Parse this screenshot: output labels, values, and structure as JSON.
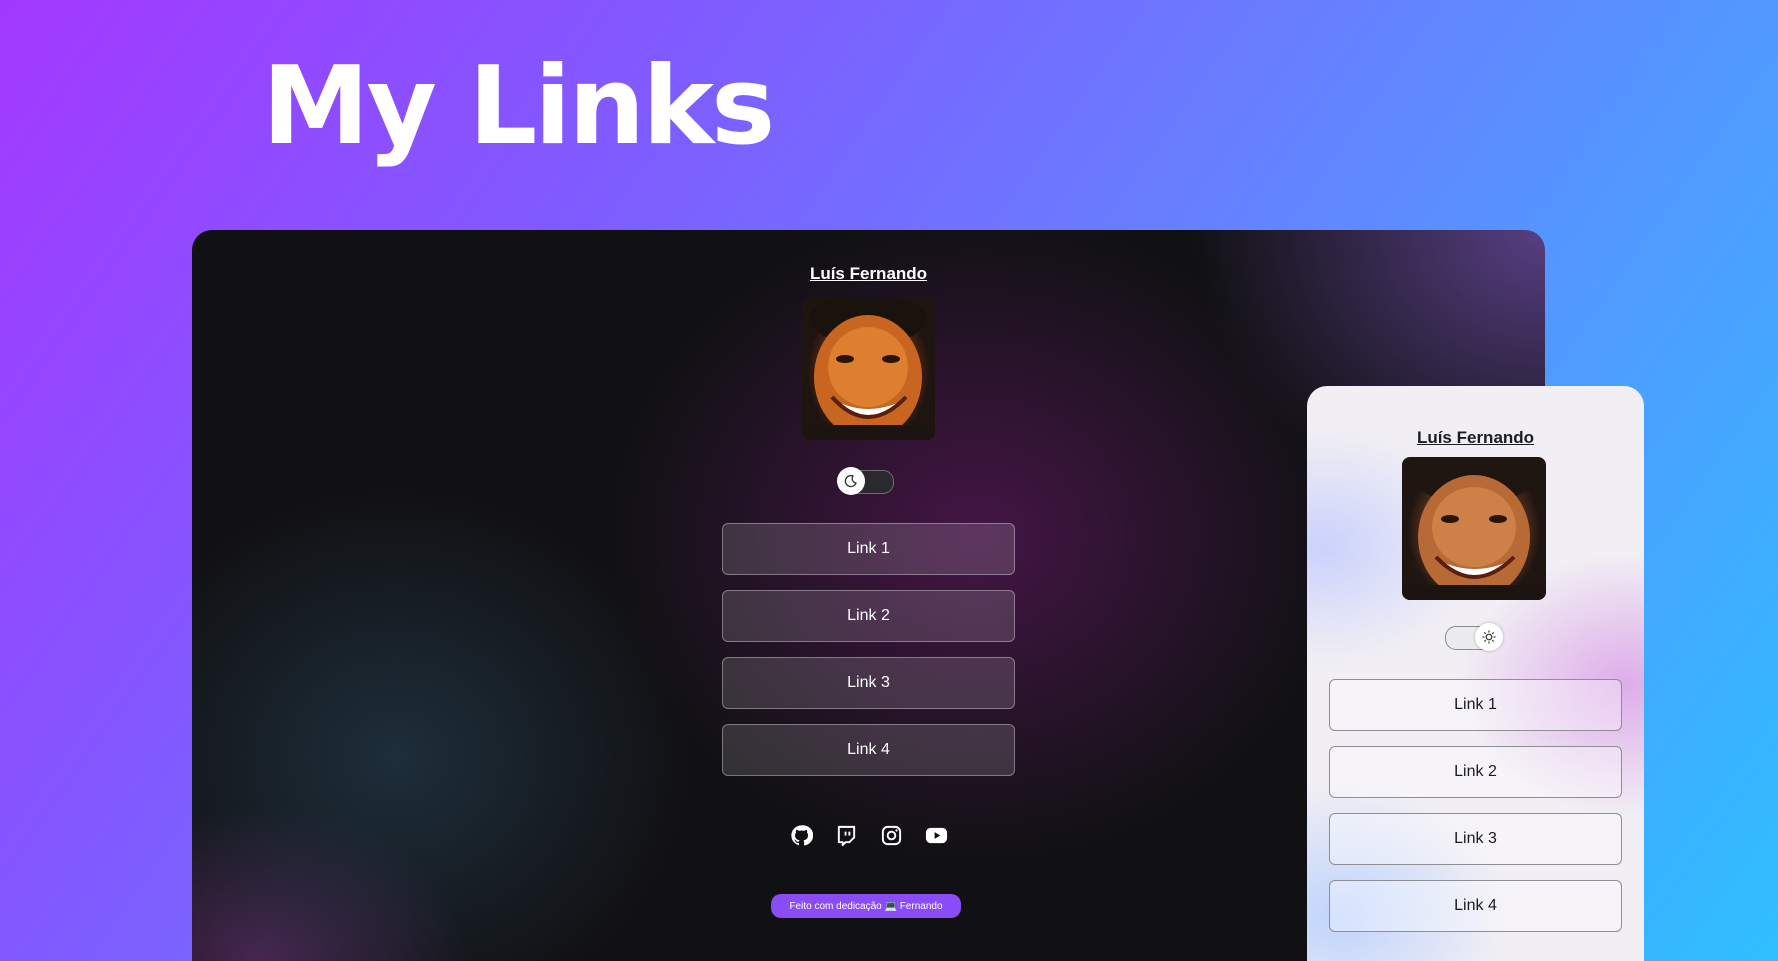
{
  "hero": {
    "title": "My Links"
  },
  "dark_preview": {
    "profile_name": "Luís Fernando",
    "theme_toggle_icon": "moon-icon",
    "links": [
      {
        "label": "Link 1"
      },
      {
        "label": "Link 2"
      },
      {
        "label": "Link 3"
      },
      {
        "label": "Link 4"
      }
    ],
    "socials": [
      "github-icon",
      "twitch-icon",
      "instagram-icon",
      "youtube-icon"
    ],
    "footer": "Feito com dedicação 💻 Fernando"
  },
  "light_preview": {
    "profile_name": "Luís Fernando",
    "theme_toggle_icon": "sun-icon",
    "links": [
      {
        "label": "Link 1"
      },
      {
        "label": "Link 2"
      },
      {
        "label": "Link 3"
      },
      {
        "label": "Link 4"
      }
    ]
  },
  "colors": {
    "footer_badge": "#8a4cf5",
    "gradient_start": "#a338ff",
    "gradient_end": "#2fbfff"
  }
}
